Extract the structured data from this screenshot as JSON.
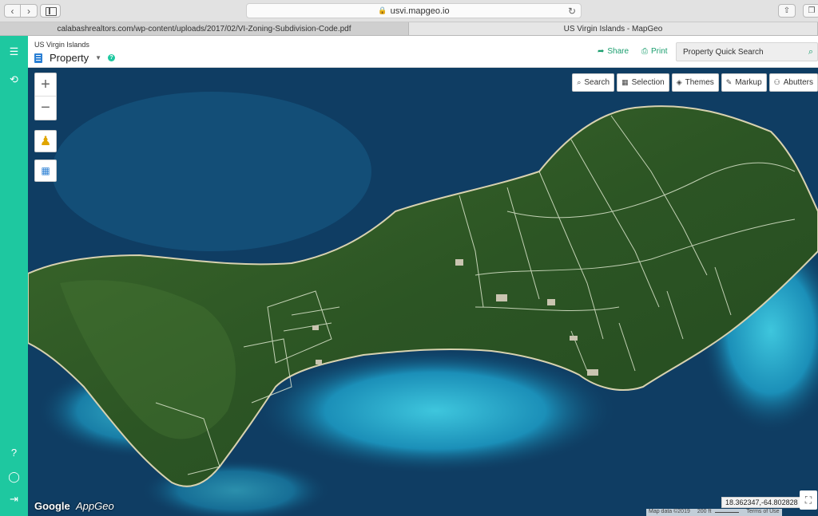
{
  "browser": {
    "url": "usvi.mapgeo.io",
    "tabs": [
      {
        "label": "calabashrealtors.com/wp-content/uploads/2017/02/VI-Zoning-Subdivision-Code.pdf"
      },
      {
        "label": "US Virgin Islands - MapGeo"
      }
    ]
  },
  "header": {
    "region": "US Virgin Islands",
    "layer": "Property",
    "share_label": "Share",
    "print_label": "Print",
    "search_placeholder": "Property Quick Search"
  },
  "toolbar": {
    "search": "Search",
    "selection": "Selection",
    "themes": "Themes",
    "markup": "Markup",
    "abutters": "Abutters"
  },
  "footer": {
    "google": "Google",
    "appgeo": "AppGeo",
    "coordinates": "18.362347,-64.802828",
    "map_data": "Map data ©2019",
    "scale": "200 ft",
    "terms": "Terms of Use"
  },
  "colors": {
    "accent": "#1ec8a0",
    "link": "#1a9e6e",
    "ocean_deep": "#0e3a5e",
    "reef": "#1fa3c8",
    "land": "#2f5a26",
    "parcel_line": "#e8f0d8"
  }
}
